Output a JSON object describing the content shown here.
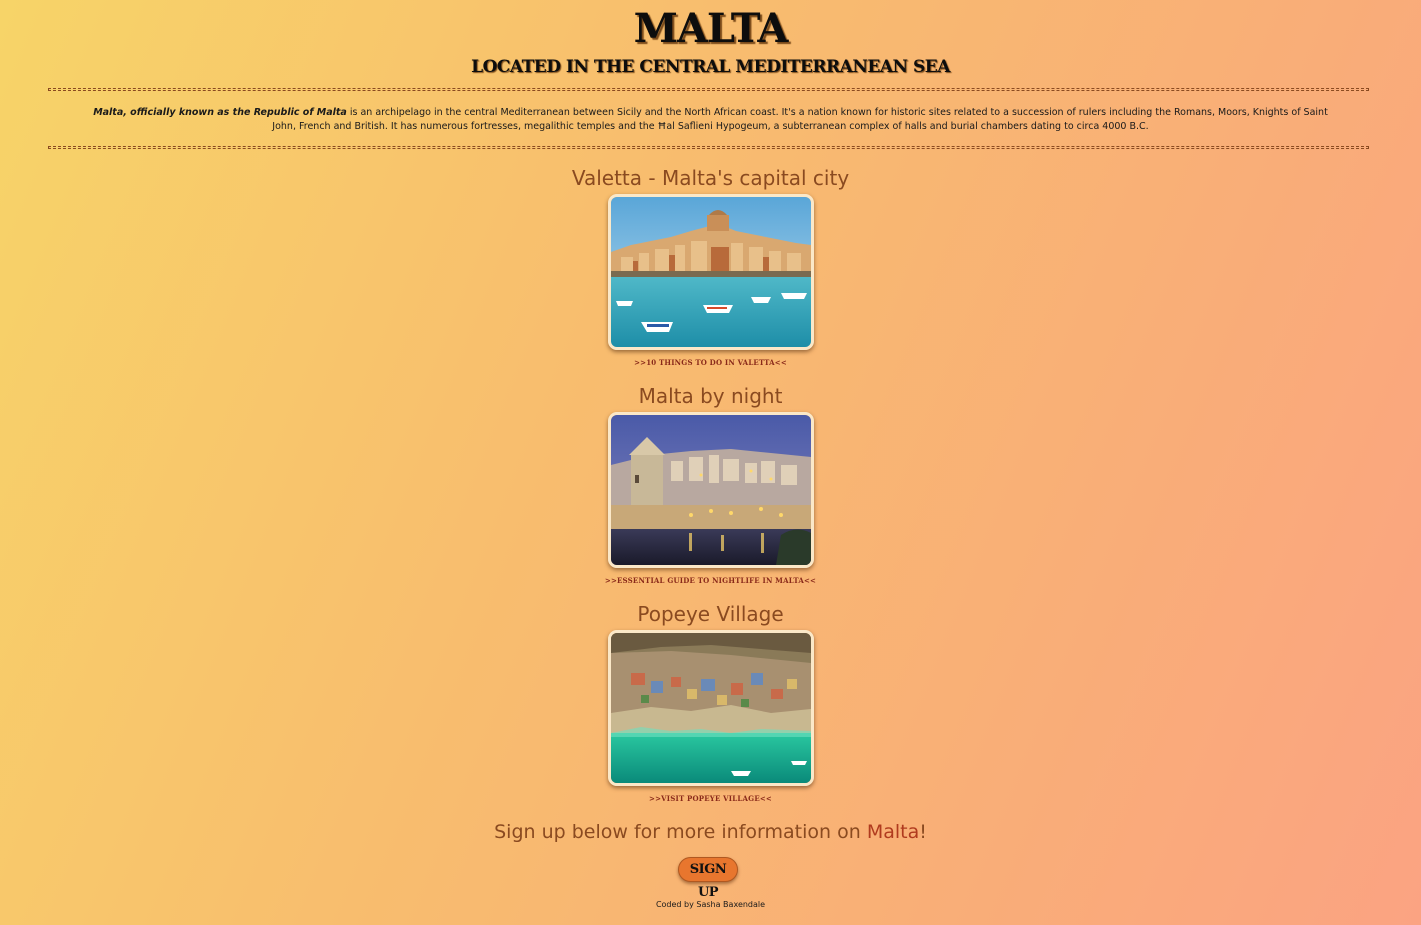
{
  "header": {
    "title": "MALTA",
    "subtitle": "LOCATED IN THE CENTRAL MEDITERRANEAN SEA"
  },
  "intro": {
    "lead": "Malta, officially known as the Republic of Malta",
    "body": " is an archipelago in the central Mediterranean between Sicily and the North African coast. It's a nation known for historic sites related to a succession of rulers including the Romans, Moors, Knights of Saint John, French and British. It has numerous fortresses, megalithic temples and the Ħal Saflieni Hypogeum, a subterranean complex of halls and burial chambers dating to circa 4000 B.C."
  },
  "sections": [
    {
      "heading": "Valetta - Malta's capital city",
      "link_label": ">>10 things to do in Valetta<<",
      "image_subject": "valletta-harbour-photo"
    },
    {
      "heading": "Malta by night",
      "link_label": ">>Essential guide to nightlife in Malta<<",
      "image_subject": "malta-night-photo"
    },
    {
      "heading": "Popeye Village",
      "link_label": ">>Visit Popeye Village<<",
      "image_subject": "popeye-village-photo"
    }
  ],
  "signup": {
    "text_before": "Sign up below for more information on ",
    "accent": "Malta",
    "text_after": "!",
    "button_label": "SIGN UP"
  },
  "footer": {
    "credit": "Coded by Sasha Baxendale"
  },
  "colors": {
    "heading": "#8a4a20",
    "accent": "#b03a1e",
    "button": "#e8762e"
  }
}
